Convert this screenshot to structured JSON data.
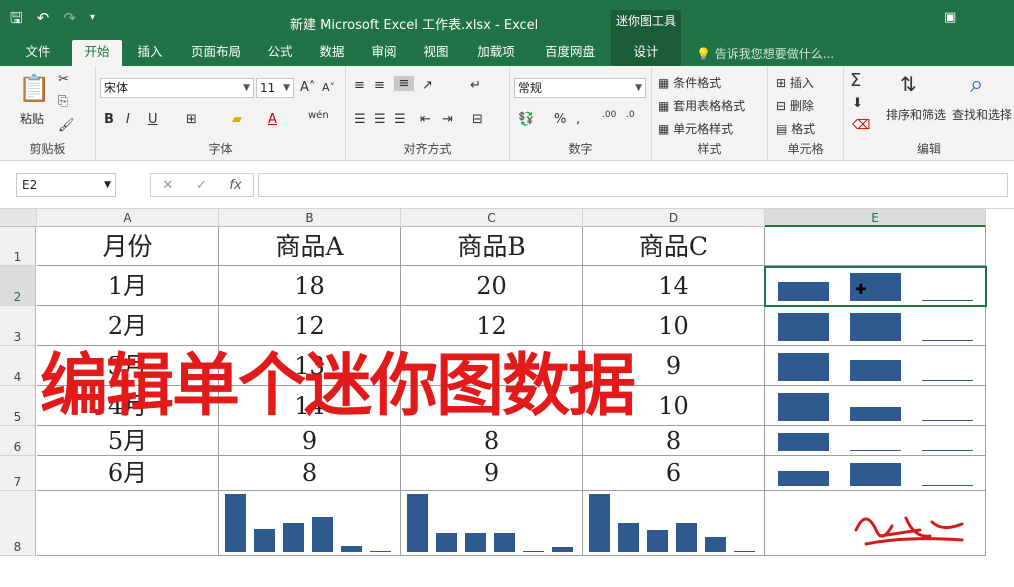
{
  "window": {
    "title": "新建 Microsoft Excel 工作表.xlsx - Excel",
    "context_header": "迷你图工具"
  },
  "tabs": [
    "文件",
    "开始",
    "插入",
    "页面布局",
    "公式",
    "数据",
    "审阅",
    "视图",
    "加载项",
    "百度网盘",
    "设计"
  ],
  "tell_me": "告诉我您想要做什么...",
  "ribbon": {
    "clipboard": {
      "paste": "粘贴",
      "label": "剪贴板"
    },
    "font": {
      "name": "宋体",
      "size": "11",
      "label": "字体"
    },
    "align": {
      "label": "对齐方式"
    },
    "number": {
      "format": "常规",
      "label": "数字"
    },
    "styles": {
      "cond": "条件格式",
      "table": "套用表格格式",
      "cell": "单元格样式",
      "label": "样式"
    },
    "cells": {
      "insert": "插入",
      "delete": "删除",
      "format": "格式",
      "label": "单元格"
    },
    "edit": {
      "sort": "排序和筛选",
      "find": "查找和选择",
      "label": "编辑"
    }
  },
  "name_box": "E2",
  "columns": [
    "A",
    "B",
    "C",
    "D",
    "E"
  ],
  "rows": [
    "1",
    "2",
    "3",
    "4",
    "5",
    "6",
    "7",
    "8"
  ],
  "headers": [
    "月份",
    "商品A",
    "商品B",
    "商品C"
  ],
  "table": [
    [
      "1月",
      "18",
      "20",
      "14"
    ],
    [
      "2月",
      "12",
      "12",
      "10"
    ],
    [
      "3月",
      "13",
      "",
      "9"
    ],
    [
      "4月",
      "14",
      "",
      "10"
    ],
    [
      "5月",
      "9",
      "8",
      "8"
    ],
    [
      "6月",
      "8",
      "9",
      "6"
    ]
  ],
  "overlay_caption": "编辑单个迷你图数据",
  "colors": {
    "accent": "#217346",
    "spark": "#2f5a8f",
    "overlay": "#e21a1a"
  },
  "sparkline_cols": [
    {
      "values": [
        18,
        12,
        13,
        14,
        9,
        8
      ]
    },
    {
      "values": [
        20,
        12,
        12,
        12,
        8,
        9
      ]
    },
    {
      "values": [
        14,
        10,
        9,
        10,
        8,
        6
      ]
    }
  ],
  "sparkline_rows": [
    {
      "values": [
        18,
        20,
        14
      ]
    },
    {
      "values": [
        12,
        12,
        10
      ]
    },
    {
      "values": [
        13,
        12,
        9
      ]
    },
    {
      "values": [
        14,
        12,
        10
      ]
    },
    {
      "values": [
        9,
        8,
        8
      ]
    },
    {
      "values": [
        8,
        9,
        6
      ]
    }
  ]
}
